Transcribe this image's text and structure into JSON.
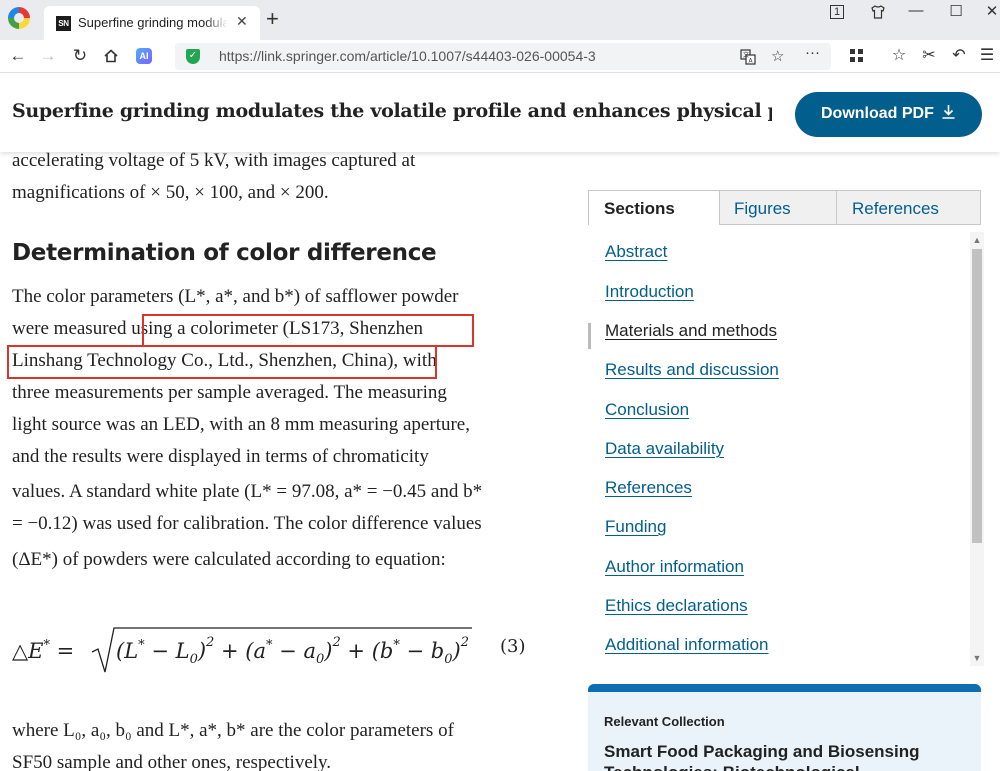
{
  "browser": {
    "tab_title": "Superfine grinding modulates the volatile profile",
    "tab_favicon_text": "SN",
    "tab_close": "✕",
    "new_tab": "+",
    "url": "https://link.springer.com/article/10.1007/s44403-026-00054-3",
    "ai_badge": "AI",
    "window_controls": [
      "1",
      "⧉",
      "—",
      "☐",
      "✕"
    ]
  },
  "header": {
    "article_title": "Superfine grinding modulates the volatile profile and enhances physical properties, c...",
    "download_label": "Download PDF",
    "download_icon": "download-icon"
  },
  "article": {
    "intro_lines": [
      "accelerating voltage of 5 kV, with images captured at",
      "magnifications of × 50, × 100, and × 200."
    ],
    "section_heading": "Determination of color difference",
    "paragraph_lines": [
      "The color parameters (L*, a*, and b*) of safflower powder",
      "were measured using a colorimeter (LS173, Shenzhen",
      "Linshang Technology Co., Ltd., Shenzhen, China), with",
      "three measurements per sample averaged. The measuring",
      "light source was an LED, with an 8 mm measuring aperture,",
      "and the results were displayed in terms of chromaticity",
      "values. A standard white plate (L* = 97.08, a* = −0.45 and b*",
      "= −0.12) was used for calibration. The color difference values",
      "(ΔE*) of powders were calculated according to equation:"
    ],
    "equation": "ΔE* = √((L* − L₀)² + (a* − a₀)² + (b* − b₀)²)",
    "equation_number": "(3)",
    "after_lines": [
      "where L₀, a₀, b₀ and L*, a*, b* are the color parameters of",
      "SF50 sample and other ones, respectively."
    ]
  },
  "sidebar": {
    "tabs": [
      "Sections",
      "Figures",
      "References"
    ],
    "sections": [
      "Abstract",
      "Introduction",
      "Materials and methods",
      "Results and discussion",
      "Conclusion",
      "Data availability",
      "References",
      "Funding",
      "Author information",
      "Ethics declarations",
      "Additional information"
    ],
    "current_section": "Materials and methods",
    "collection_label": "Relevant Collection",
    "collection_title": "Smart Food Packaging and Biosensing Technologies: Biotechnological"
  },
  "colors": {
    "accent": "#025e8d",
    "highlight": "#d9352b"
  }
}
